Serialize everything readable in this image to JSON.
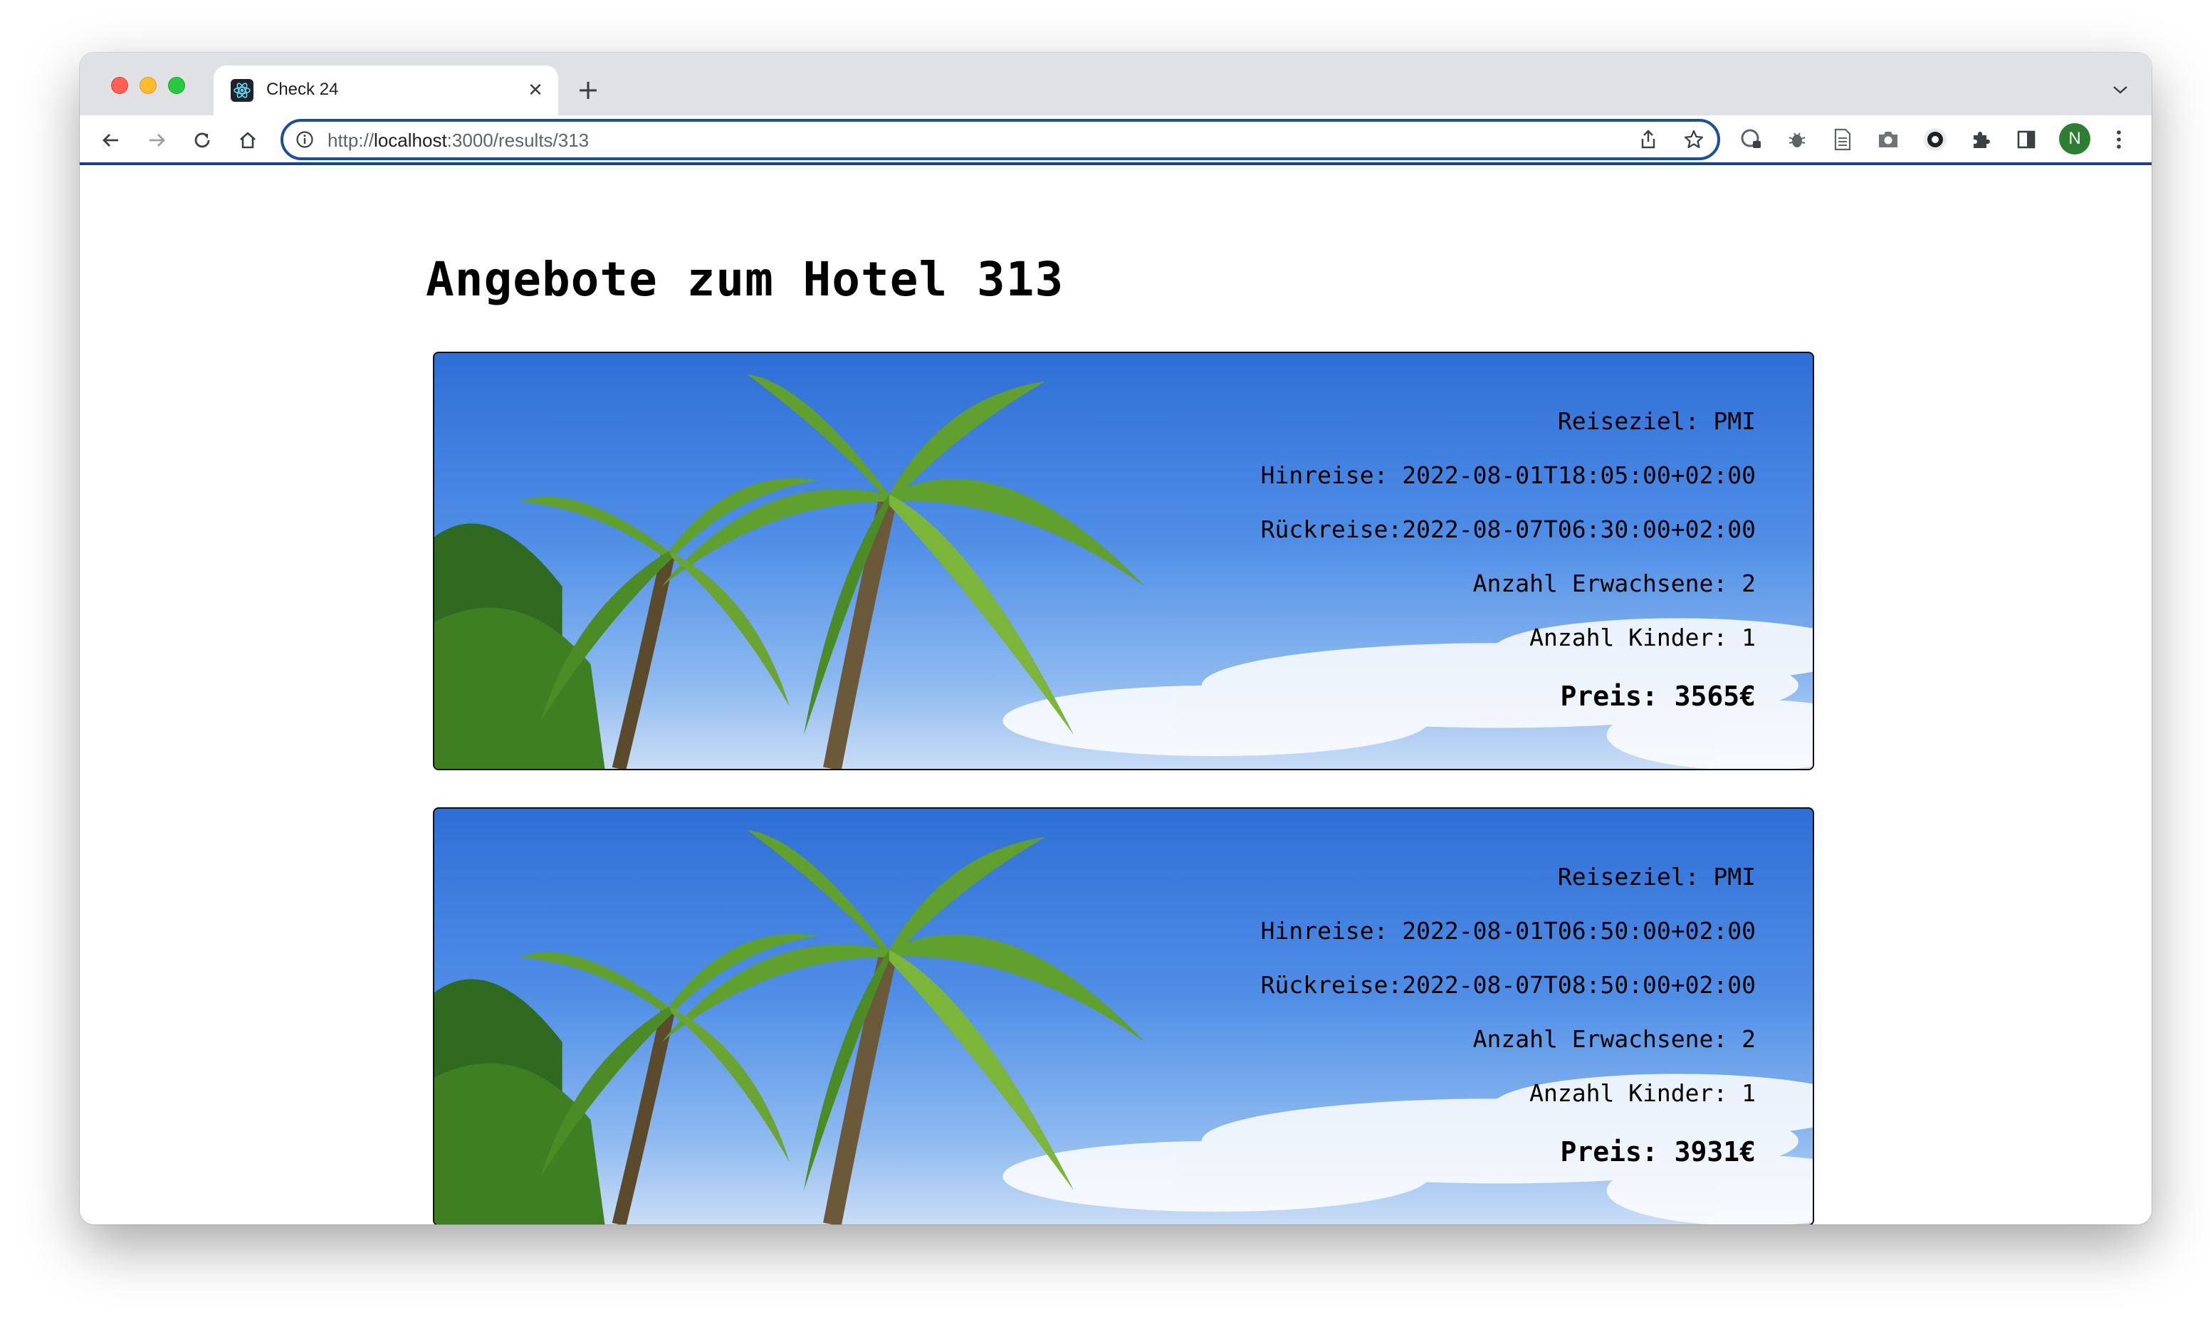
{
  "browser": {
    "tab_title": "Check 24",
    "url_prefix": "http://",
    "url_host": "localhost",
    "url_rest": ":3000/results/313",
    "profile_initial": "N"
  },
  "page": {
    "title": "Angebote zum Hotel 313"
  },
  "offers": [
    {
      "destination": "Reiseziel: PMI",
      "outbound": "Hinreise: 2022-08-01T18:05:00+02:00",
      "return": "Rückreise:2022-08-07T06:30:00+02:00",
      "adults": "Anzahl Erwachsene: 2",
      "children": "Anzahl Kinder: 1",
      "price": "Preis: 3565€"
    },
    {
      "destination": "Reiseziel: PMI",
      "outbound": "Hinreise: 2022-08-01T06:50:00+02:00",
      "return": "Rückreise:2022-08-07T08:50:00+02:00",
      "adults": "Anzahl Erwachsene: 2",
      "children": "Anzahl Kinder: 1",
      "price": "Preis: 3931€"
    }
  ],
  "colors": {
    "accent": "#2b6bbf",
    "omnibox_border": "#1a4fa0",
    "sky_top": "#2f6fd6",
    "palm_green": "#4f9a2a"
  },
  "icons": {
    "back": "arrow-left-icon",
    "forward": "arrow-right-icon",
    "reload": "reload-icon",
    "home": "home-icon",
    "site_info": "info-icon",
    "share": "share-icon",
    "bookmark": "star-icon",
    "extensions": "puzzle-icon",
    "side_panel": "side-panel-icon",
    "menu": "kebab-menu-icon"
  }
}
